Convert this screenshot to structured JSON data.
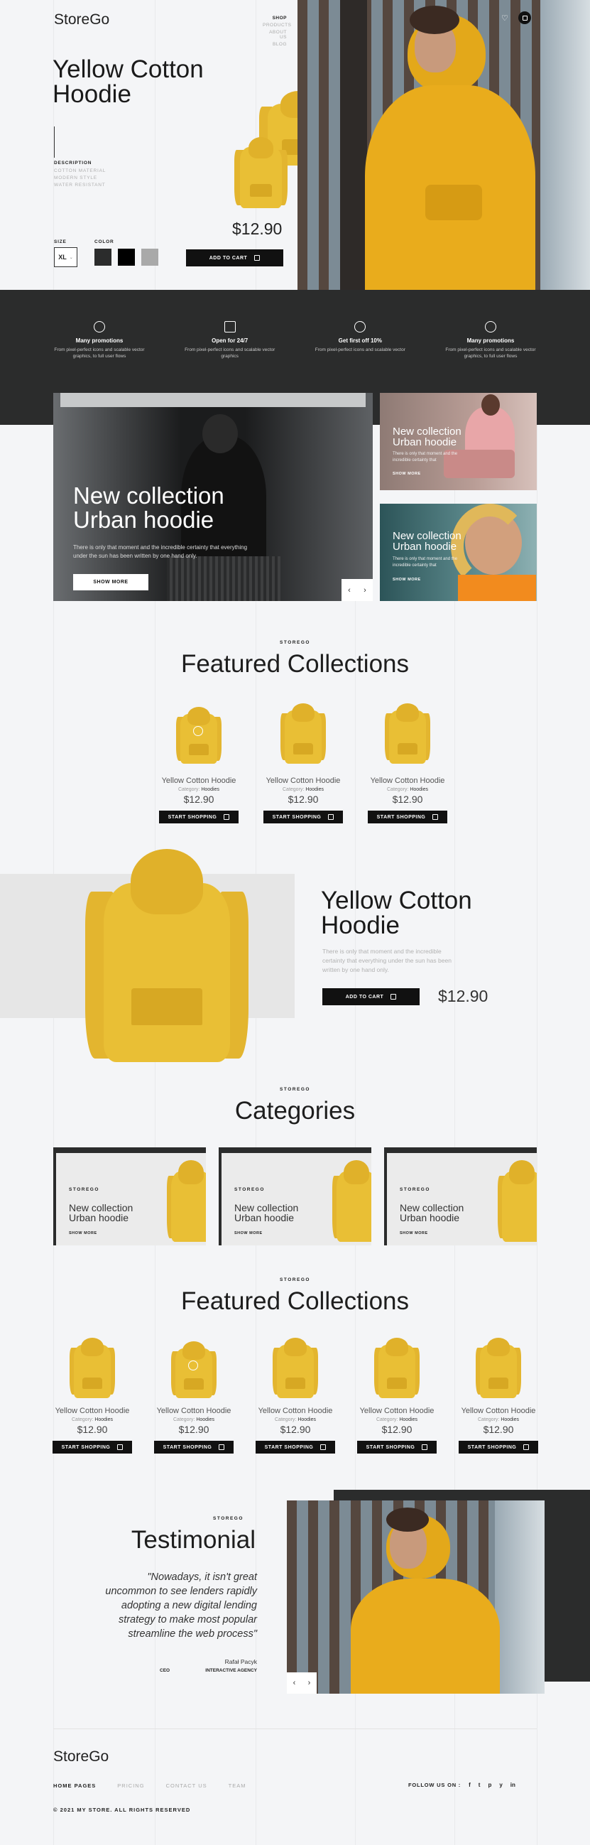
{
  "brand": "StoreGo",
  "nav": {
    "items": [
      "SHOP",
      "PRODUCTS",
      "ABOUT US",
      "BLOG"
    ]
  },
  "hero": {
    "title_line1": "Yellow Cotton",
    "title_line2": "Hoodie",
    "description_label": "DESCRIPTION",
    "description_items": [
      "COTTON MATERIAL",
      "MODERN STYLE",
      "WATER RESISTANT"
    ],
    "size_label": "SIZE",
    "size_value": "XL",
    "color_label": "COLOR",
    "colors": [
      "#2b2c2c",
      "#000000",
      "#a9a9a9"
    ],
    "price": "$12.90",
    "add_to_cart": "ADD TO CART"
  },
  "features": [
    {
      "title": "Many promotions",
      "text": "From pixel-perfect icons and scalable vector graphics, to full user flows",
      "icon": "tag-icon"
    },
    {
      "title": "Open for 24/7",
      "text": "From pixel-perfect icons and scalable vector graphics",
      "icon": "store-icon"
    },
    {
      "title": "Get first off 10%",
      "text": "From pixel-perfect icons and scalable vector",
      "icon": "percent-icon"
    },
    {
      "title": "Many promotions",
      "text": "From pixel-perfect icons and scalable vector graphics, to full user flows",
      "icon": "tag-icon"
    }
  ],
  "promo_main": {
    "title_line1": "New collection",
    "title_line2": "Urban hoodie",
    "text": "There is only that moment and the incredible certainty that everything under the sun has been written by one hand only.",
    "button": "SHOW MORE"
  },
  "promo_side": [
    {
      "title_line1": "New collection",
      "title_line2": "Urban hoodie",
      "text": "There is only that moment and the incredible certainty that",
      "link": "SHOW MORE"
    },
    {
      "title_line1": "New collection",
      "title_line2": "Urban hoodie",
      "text": "There is only that moment and the incredible certainty that",
      "link": "SHOW MORE"
    }
  ],
  "featured1": {
    "eyebrow": "STOREGO",
    "title": "Featured Collections",
    "products": [
      {
        "name": "Yellow Cotton Hoodie",
        "category_label": "Category:",
        "category": "Hoodies",
        "price": "$12.90",
        "button": "START SHOPPING"
      },
      {
        "name": "Yellow Cotton Hoodie",
        "category_label": "Category:",
        "category": "Hoodies",
        "price": "$12.90",
        "button": "START SHOPPING"
      },
      {
        "name": "Yellow Cotton Hoodie",
        "category_label": "Category:",
        "category": "Hoodies",
        "price": "$12.90",
        "button": "START SHOPPING"
      }
    ]
  },
  "spotlight": {
    "title_line1": "Yellow Cotton",
    "title_line2": "Hoodie",
    "text": "There is only that moment and the incredible certainty that everything under the sun has been written by one hand only.",
    "button": "ADD TO CART",
    "price": "$12.90"
  },
  "categories": {
    "eyebrow": "STOREGO",
    "title": "Categories",
    "items": [
      {
        "brand": "STOREGO",
        "title_line1": "New collection",
        "title_line2": "Urban hoodie",
        "link": "SHOW MORE"
      },
      {
        "brand": "STOREGO",
        "title_line1": "New collection",
        "title_line2": "Urban hoodie",
        "link": "SHOW MORE"
      },
      {
        "brand": "STOREGO",
        "title_line1": "New collection",
        "title_line2": "Urban hoodie",
        "link": "SHOW MORE"
      }
    ]
  },
  "featured2": {
    "eyebrow": "STOREGO",
    "title": "Featured Collections",
    "products": [
      {
        "name": "Yellow Cotton Hoodie",
        "category_label": "Category:",
        "category": "Hoodies",
        "price": "$12.90",
        "button": "START SHOPPING"
      },
      {
        "name": "Yellow Cotton Hoodie",
        "category_label": "Category:",
        "category": "Hoodies",
        "price": "$12.90",
        "button": "START SHOPPING"
      },
      {
        "name": "Yellow Cotton Hoodie",
        "category_label": "Category:",
        "category": "Hoodies",
        "price": "$12.90",
        "button": "START SHOPPING"
      },
      {
        "name": "Yellow Cotton Hoodie",
        "category_label": "Category:",
        "category": "Hoodies",
        "price": "$12.90",
        "button": "START SHOPPING"
      },
      {
        "name": "Yellow Cotton Hoodie",
        "category_label": "Category:",
        "category": "Hoodies",
        "price": "$12.90",
        "button": "START SHOPPING"
      }
    ]
  },
  "testimonial": {
    "eyebrow": "STOREGO",
    "title": "Testimonial",
    "quote_lines": [
      "\"Nowadays, it isn't great",
      "uncommon to see lenders rapidly",
      "adopting a new digital lending",
      "strategy to make most  popular",
      "streamline the web process\""
    ],
    "author": "Rafał Pacyk",
    "role": "CEO",
    "company": "INTERACTIVE AGENCY"
  },
  "footer": {
    "brand": "StoreGo",
    "links": [
      "HOME PAGES",
      "PRICING",
      "CONTACT US",
      "TEAM"
    ],
    "follow_label": "FOLLOW US ON :",
    "social": [
      "f",
      "t",
      "p",
      "y",
      "in"
    ],
    "copyright": "© 2021 MY STORE. ALL RIGHTS RESERVED"
  }
}
